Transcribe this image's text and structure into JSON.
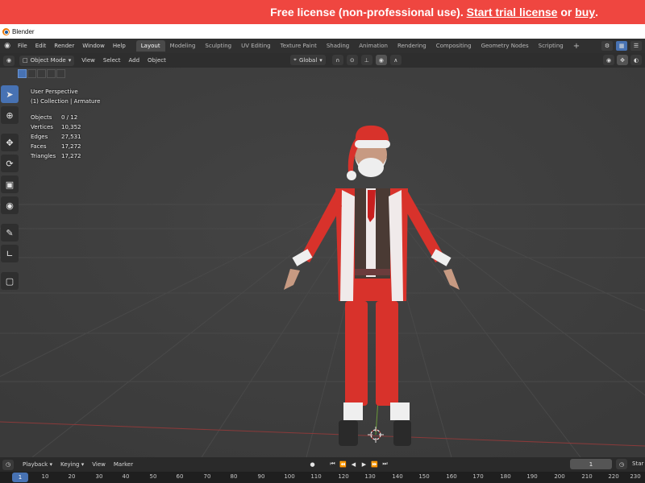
{
  "banner": {
    "prefix": "Free license (non-professional use).",
    "trial_link": "Start trial license",
    "or": "or",
    "buy_link": "buy",
    "suffix": "."
  },
  "window_title": "Blender",
  "menus": [
    "File",
    "Edit",
    "Render",
    "Window",
    "Help"
  ],
  "workspace_tabs": [
    {
      "label": "Layout",
      "active": true
    },
    {
      "label": "Modeling"
    },
    {
      "label": "Sculpting"
    },
    {
      "label": "UV Editing"
    },
    {
      "label": "Texture Paint"
    },
    {
      "label": "Shading"
    },
    {
      "label": "Animation"
    },
    {
      "label": "Rendering"
    },
    {
      "label": "Compositing"
    },
    {
      "label": "Geometry Nodes"
    },
    {
      "label": "Scripting"
    }
  ],
  "add_workspace": "+",
  "viewport_header": {
    "mode": "Object Mode",
    "menus": [
      "View",
      "Select",
      "Add",
      "Object"
    ],
    "transform_orientation": "Global"
  },
  "overlay": {
    "view_name": "User Perspective",
    "collection": "(1) Collection | Armature",
    "stats": [
      {
        "label": "Objects",
        "value": "0 / 12"
      },
      {
        "label": "Vertices",
        "value": "10,352"
      },
      {
        "label": "Edges",
        "value": "27,531"
      },
      {
        "label": "Faces",
        "value": "17,272"
      },
      {
        "label": "Triangles",
        "value": "17,272"
      }
    ]
  },
  "timeline": {
    "menus": [
      "Playback",
      "Keying",
      "View",
      "Marker"
    ],
    "current_frame": "1",
    "ruler_current": "1",
    "ruler_ticks": [
      "10",
      "20",
      "30",
      "40",
      "50",
      "60",
      "70",
      "80",
      "90",
      "100",
      "110",
      "120",
      "130",
      "140",
      "150",
      "160",
      "170",
      "180",
      "190",
      "200",
      "210",
      "220",
      "230"
    ],
    "start_label": "Star"
  },
  "colors": {
    "banner": "#ef4640",
    "accent": "#4772b3",
    "suit_red": "#d8322b"
  }
}
